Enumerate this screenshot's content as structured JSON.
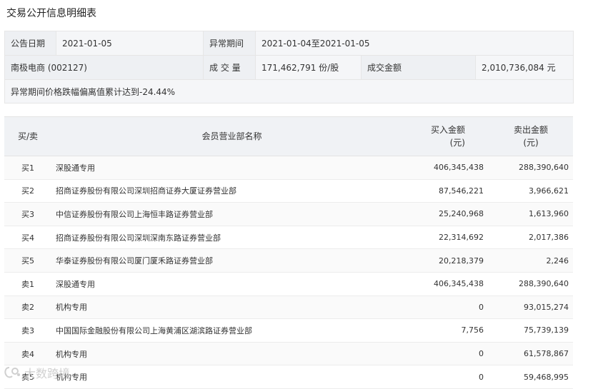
{
  "page_title": "交易公开信息明细表",
  "info": {
    "announce_date_label": "公告日期",
    "announce_date": "2021-01-05",
    "period_label": "异常期间",
    "period": "2021-01-04至2021-01-05",
    "stock": "南极电商 (002127)",
    "volume_label": "成 交 量",
    "volume": "171,462,791 份/股",
    "amount_label": "成交金额",
    "amount": "2,010,736,084 元",
    "note": "异常期间价格跌幅偏离值累计达到-24.44%"
  },
  "table": {
    "headers": {
      "side": "买/卖",
      "dept": "会员营业部名称",
      "buy_line1": "买入金额",
      "buy_line2": "(元)",
      "sell_line1": "卖出金额",
      "sell_line2": "(元)"
    },
    "rows": [
      {
        "side": "买1",
        "name": "深股通专用",
        "buy": "406,345,438",
        "sell": "288,390,640"
      },
      {
        "side": "买2",
        "name": "招商证券股份有限公司深圳招商证券大厦证券营业部",
        "buy": "87,546,221",
        "sell": "3,966,621"
      },
      {
        "side": "买3",
        "name": "中信证券股份有限公司上海恒丰路证券营业部",
        "buy": "25,240,968",
        "sell": "1,613,960"
      },
      {
        "side": "买4",
        "name": "招商证券股份有限公司深圳深南东路证券营业部",
        "buy": "22,314,692",
        "sell": "2,017,386"
      },
      {
        "side": "买5",
        "name": "华泰证券股份有限公司厦门厦禾路证券营业部",
        "buy": "20,218,379",
        "sell": "2,246"
      },
      {
        "side": "卖1",
        "name": "深股通专用",
        "buy": "406,345,438",
        "sell": "288,390,640"
      },
      {
        "side": "卖2",
        "name": "机构专用",
        "buy": "0",
        "sell": "93,015,274"
      },
      {
        "side": "卖3",
        "name": "中国国际金融股份有限公司上海黄浦区湖滨路证券营业部",
        "buy": "7,756",
        "sell": "75,739,139"
      },
      {
        "side": "卖4",
        "name": "机构专用",
        "buy": "0",
        "sell": "61,578,867"
      },
      {
        "side": "卖5",
        "name": "机构专用",
        "buy": "0",
        "sell": "59,468,995"
      }
    ]
  },
  "watermark": {
    "text": "大数跨境",
    "icon": "brand-logo-icon"
  }
}
